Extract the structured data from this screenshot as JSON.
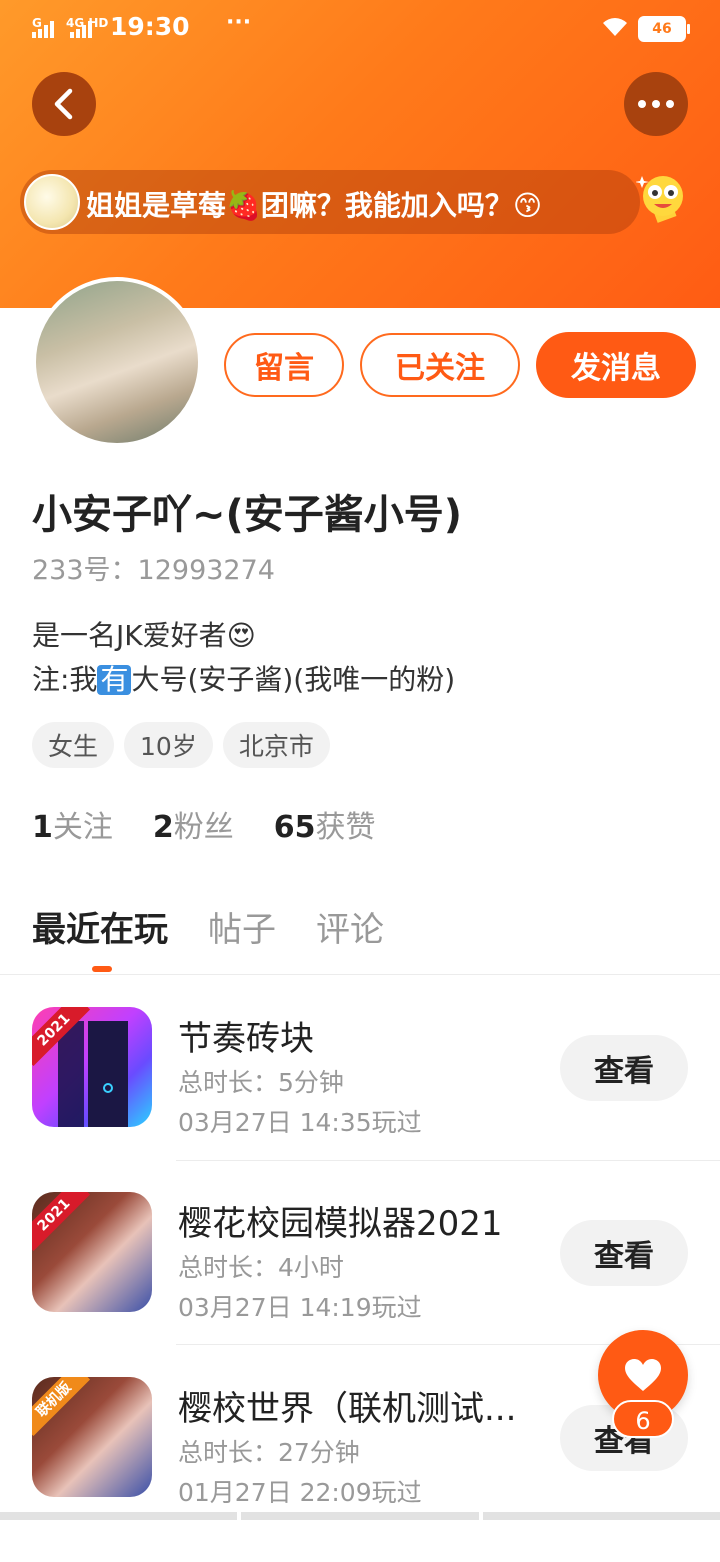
{
  "status_bar": {
    "carrier1": "G",
    "carrier2": "4G HD",
    "time": "19:30",
    "more": "···",
    "battery": "46"
  },
  "header": {
    "banner_text": "姐姐是草莓🍓团嘛？我能加入吗？😙",
    "back_icon": "chevron-left-icon",
    "more_icon": "more-horizontal-icon",
    "accent": "#ff6a1a"
  },
  "actions": {
    "message_board": "留言",
    "following": "已关注",
    "send_message": "发消息"
  },
  "profile": {
    "name": "小安子吖~(安子酱小号)",
    "uid": "233号：12993274",
    "bio_line1": "是一名JK爱好者😍",
    "bio_line2_prefix": "注:我",
    "bio_line2_box": "有",
    "bio_line2_suffix": "大号(安子酱)(我唯一的粉)",
    "tags": [
      "女生",
      "10岁",
      "北京市"
    ]
  },
  "stats": {
    "following_count": "1",
    "following_label": "关注",
    "fans_count": "2",
    "fans_label": "粉丝",
    "likes_count": "65",
    "likes_label": "获赞"
  },
  "tabs": [
    "最近在玩",
    "帖子",
    "评论"
  ],
  "games": [
    {
      "title": "节奏砖块",
      "duration": "总时长：5分钟",
      "played": "03月27日 14:35玩过",
      "badge": "2021",
      "button": "查看"
    },
    {
      "title": "樱花校园模拟器2021",
      "duration": "总时长：4小时",
      "played": "03月27日 14:19玩过",
      "badge": "2021",
      "button": "查看"
    },
    {
      "title": "樱校世界（联机测试...",
      "duration": "总时长：27分钟",
      "played": "01月27日 22:09玩过",
      "badge": "联机版",
      "button": "查看"
    }
  ],
  "like_fab": {
    "count": "6",
    "icon": "heart-icon"
  }
}
